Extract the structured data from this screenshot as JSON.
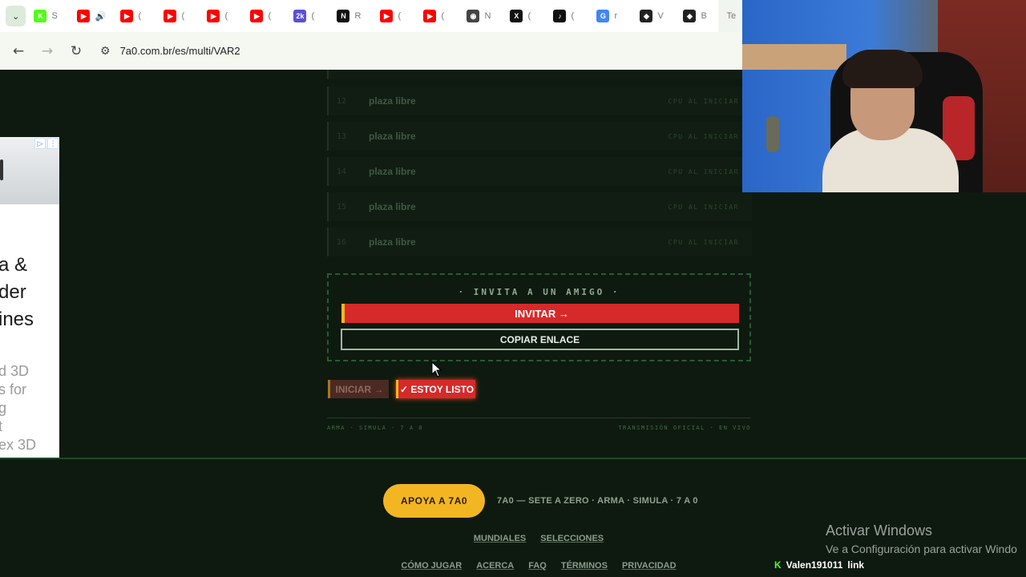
{
  "browser": {
    "tabs": [
      {
        "icon": "kick-icon",
        "color": "#53fc18",
        "glyph": "K",
        "title": "S"
      },
      {
        "icon": "youtube-icon",
        "color": "#ff0000",
        "glyph": "▶",
        "title": "🔊"
      },
      {
        "icon": "youtube-icon",
        "color": "#ff0000",
        "glyph": "▶",
        "title": "("
      },
      {
        "icon": "youtube-icon",
        "color": "#ff0000",
        "glyph": "▶",
        "title": "("
      },
      {
        "icon": "youtube-icon",
        "color": "#ff0000",
        "glyph": "▶",
        "title": "("
      },
      {
        "icon": "youtube-icon",
        "color": "#ff0000",
        "glyph": "▶",
        "title": "("
      },
      {
        "icon": "badge-icon",
        "color": "#5b4fd6",
        "glyph": "2k",
        "title": "("
      },
      {
        "icon": "news-icon",
        "color": "#111111",
        "glyph": "N",
        "title": "R"
      },
      {
        "icon": "youtube-icon",
        "color": "#ff0000",
        "glyph": "▶",
        "title": "("
      },
      {
        "icon": "youtube-icon",
        "color": "#ff0000",
        "glyph": "▶",
        "title": "("
      },
      {
        "icon": "github-icon",
        "color": "#444444",
        "glyph": "◉",
        "title": "N"
      },
      {
        "icon": "x-icon",
        "color": "#111111",
        "glyph": "X",
        "title": "("
      },
      {
        "icon": "tiktok-icon",
        "color": "#111111",
        "glyph": "♪",
        "title": "("
      },
      {
        "icon": "google-icon",
        "color": "#4285f4",
        "glyph": "G",
        "title": "r"
      },
      {
        "icon": "shield-icon",
        "color": "#222222",
        "glyph": "◆",
        "title": "V"
      },
      {
        "icon": "shield-icon",
        "color": "#222222",
        "glyph": "◆",
        "title": "B"
      }
    ],
    "active_tab_title": "Te",
    "url": "7a0.com.br/es/multi/VAR2"
  },
  "ad": {
    "headline": [
      "a &",
      "der",
      "ines"
    ],
    "lines": [
      "d 3D",
      "s for",
      "g",
      "t",
      "ex 3D"
    ]
  },
  "slots": [
    {
      "num": "12",
      "name": "plaza libre",
      "status": "CPU AL INICIAR"
    },
    {
      "num": "13",
      "name": "plaza libre",
      "status": "CPU AL INICIAR"
    },
    {
      "num": "14",
      "name": "plaza libre",
      "status": "CPU AL INICIAR"
    },
    {
      "num": "15",
      "name": "plaza libre",
      "status": "CPU AL INICIAR"
    },
    {
      "num": "16",
      "name": "plaza libre",
      "status": "CPU AL INICIAR"
    }
  ],
  "invite": {
    "title": "· INVITA A UN AMIGO ·",
    "invite_label": "INVITAR →",
    "copy_label": "COPIAR ENLACE"
  },
  "actions": {
    "start_label": "INICIAR →",
    "ready_label": "✓ ESTOY LISTO"
  },
  "footer": {
    "left": "ARMA · SIMULA · 7 A 0",
    "right": "TRANSMISIÓN OFICIAL · EN VIVO",
    "support_label": "APOYA A 7A0",
    "tagline": "7A0 — SETE A ZERO · ARMA · SIMULA · 7 A 0",
    "links_row1": [
      "MUNDIALES",
      "SELECCIONES"
    ],
    "links_row2": [
      "CÓMO JUGAR",
      "ACERCA",
      "FAQ",
      "TÉRMINOS",
      "PRIVACIDAD"
    ]
  },
  "overlay": {
    "activate_title": "Activar Windows",
    "activate_sub": "Ve a Configuración para activar Windo",
    "kick_user": "Valen191011",
    "kick_link": "link"
  }
}
